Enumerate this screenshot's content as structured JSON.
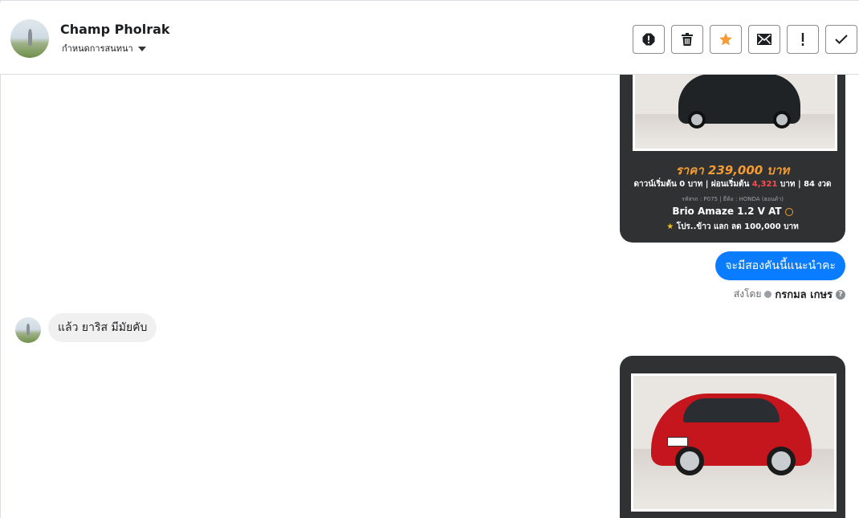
{
  "header": {
    "contact_name": "Champ Pholrak",
    "conversation_setting": "กำหนดการสนทนา",
    "actions": [
      {
        "name": "mark-spam-button",
        "icon": "alert-circle-icon"
      },
      {
        "name": "delete-button",
        "icon": "trash-icon"
      },
      {
        "name": "star-button",
        "icon": "star-icon"
      },
      {
        "name": "mark-unread-button",
        "icon": "envelope-icon"
      },
      {
        "name": "follow-up-button",
        "icon": "exclamation-icon"
      },
      {
        "name": "mark-done-button",
        "icon": "checkmark-icon"
      }
    ]
  },
  "card1": {
    "price": "ราคา 239,000 บาท",
    "down_prefix": "ดาวน์เริ่มต้น 0 บาท | ผ่อนเริ่มต้น ",
    "down_installment": "4,321",
    "down_suffix": " บาท | 84 งวด",
    "code": "รหัสรถ : P075 | ยี่ห้อ : HONDA (ฮอนด้า)",
    "model": "Brio Amaze 1.2 V AT",
    "promo": "โปร..ข้าว แลก ลด 100,000 บาท"
  },
  "messages": {
    "outgoing": "จะมีสองคันนี้แนะนำคะ",
    "sent_by_label": "ส่งโดย",
    "sender": "กรกมล เกษร",
    "incoming": "แล้ว ยาริส มีมัยคับ"
  },
  "colors": {
    "accent": "#0a7cff",
    "price": "#f39c34",
    "star": "#f39c34"
  }
}
